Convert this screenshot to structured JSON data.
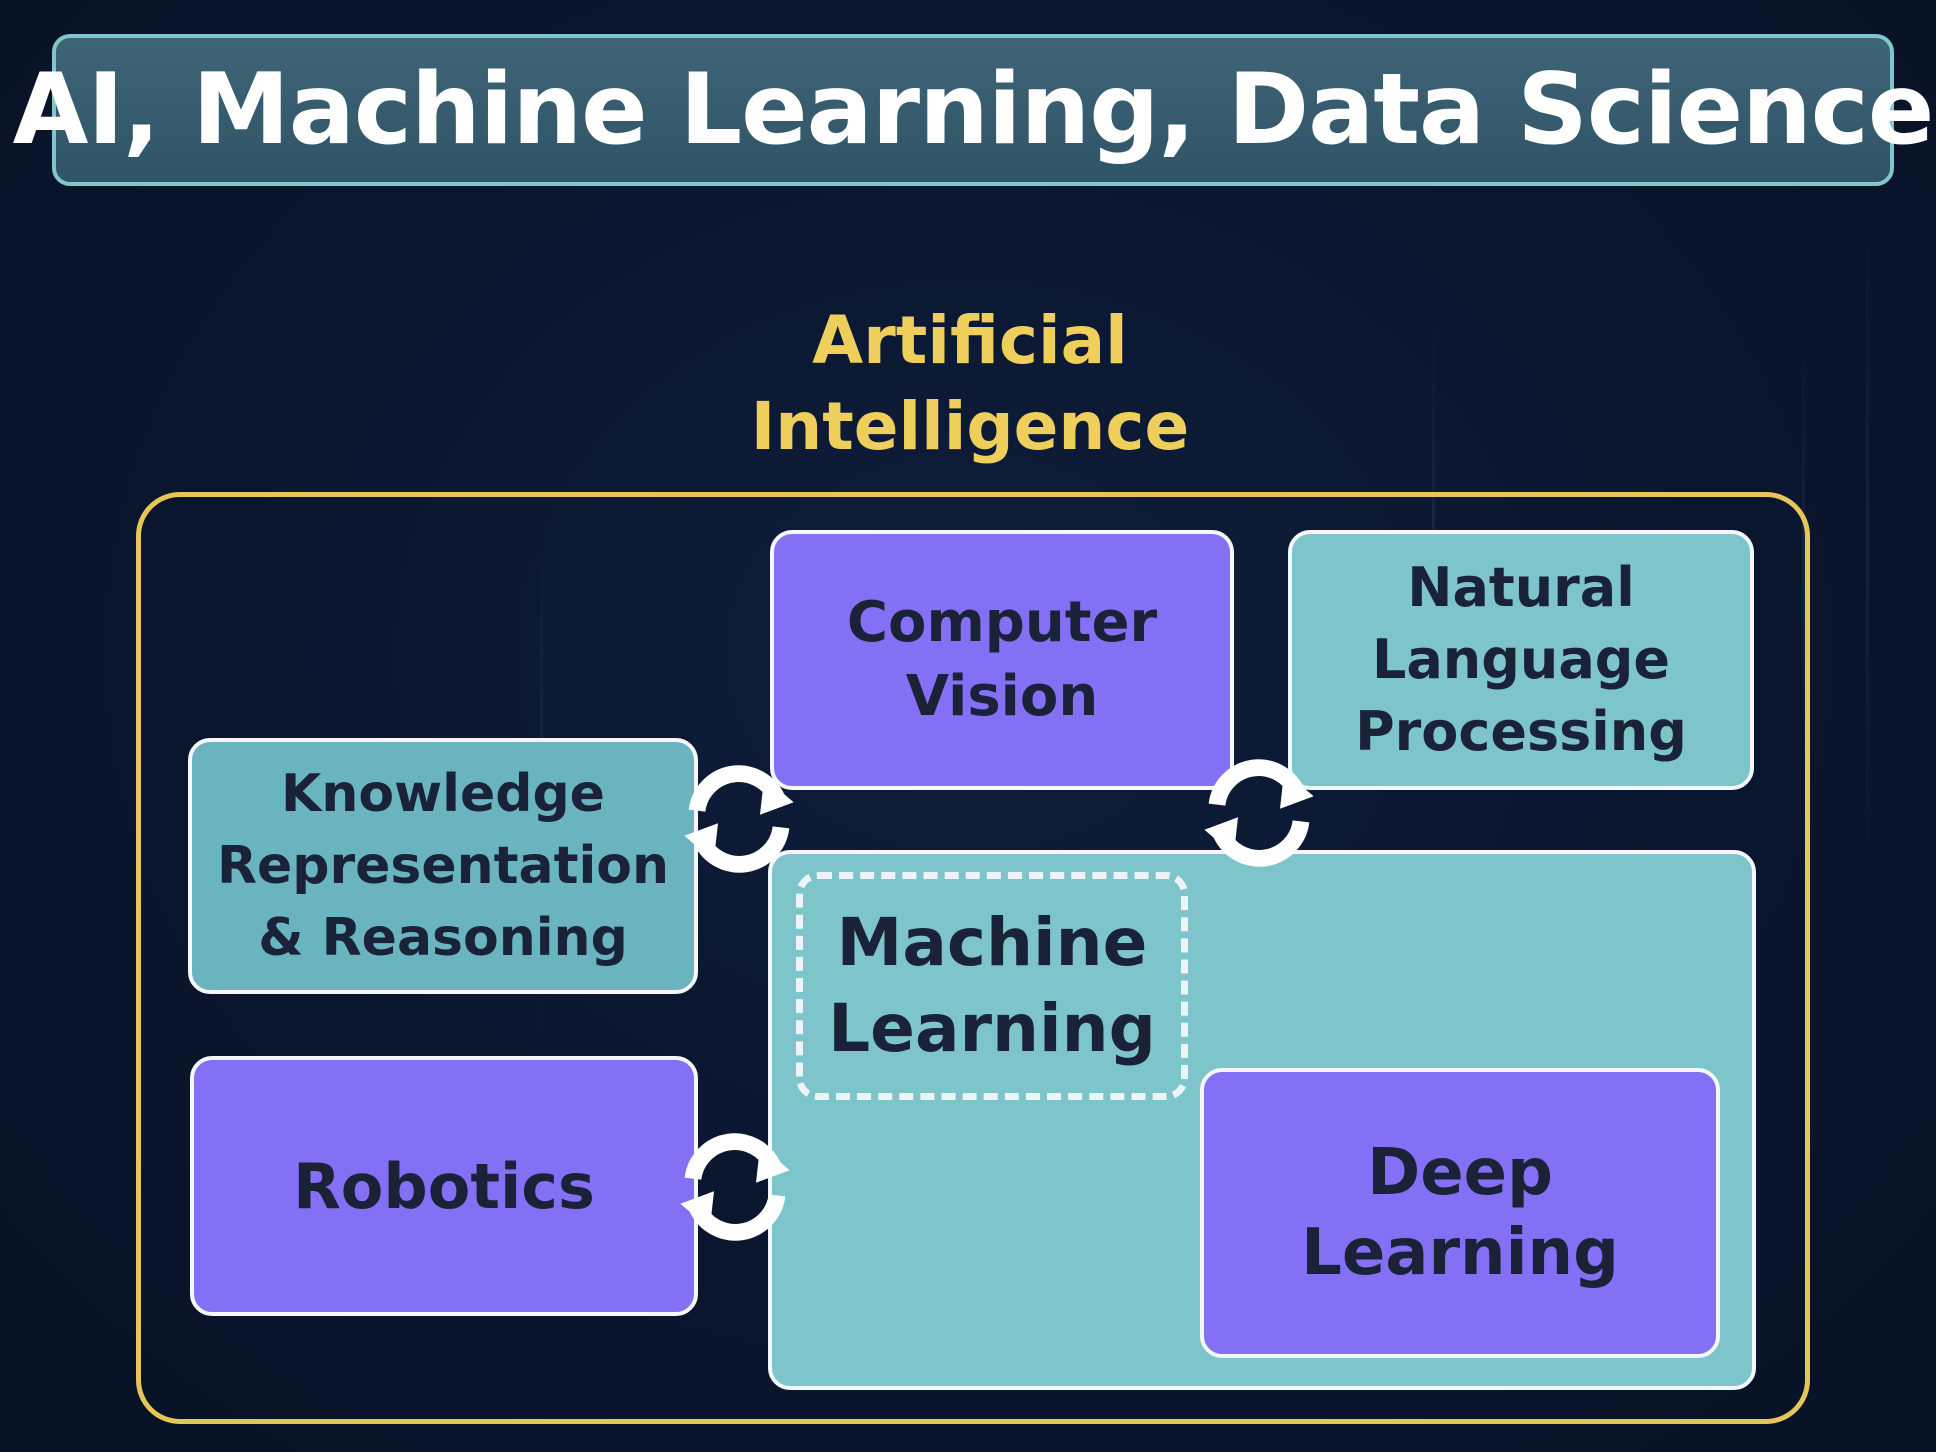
{
  "title": "AI, Machine Learning, Data Science",
  "diagram": {
    "outer_label_line1": "Artificial",
    "outer_label_line2": "Intelligence",
    "nodes": {
      "computer_vision": [
        "Computer",
        "Vision"
      ],
      "nlp": [
        "Natural",
        "Language",
        "Processing"
      ],
      "knowledge": [
        "Knowledge",
        "Representation",
        "& Reasoning"
      ],
      "robotics": [
        "Robotics"
      ],
      "machine_learning": [
        "Machine",
        "Learning"
      ],
      "deep_learning": [
        "Deep",
        "Learning"
      ]
    },
    "connector_icon": "cycle-arrows-icon",
    "colors": {
      "background": "#0b1730",
      "title_fill": "#36596b",
      "title_border": "#82c6cd",
      "ai_accent": "#e6c658",
      "purple_box": "#8470f5",
      "teal_box": "#7ec4cb"
    }
  }
}
